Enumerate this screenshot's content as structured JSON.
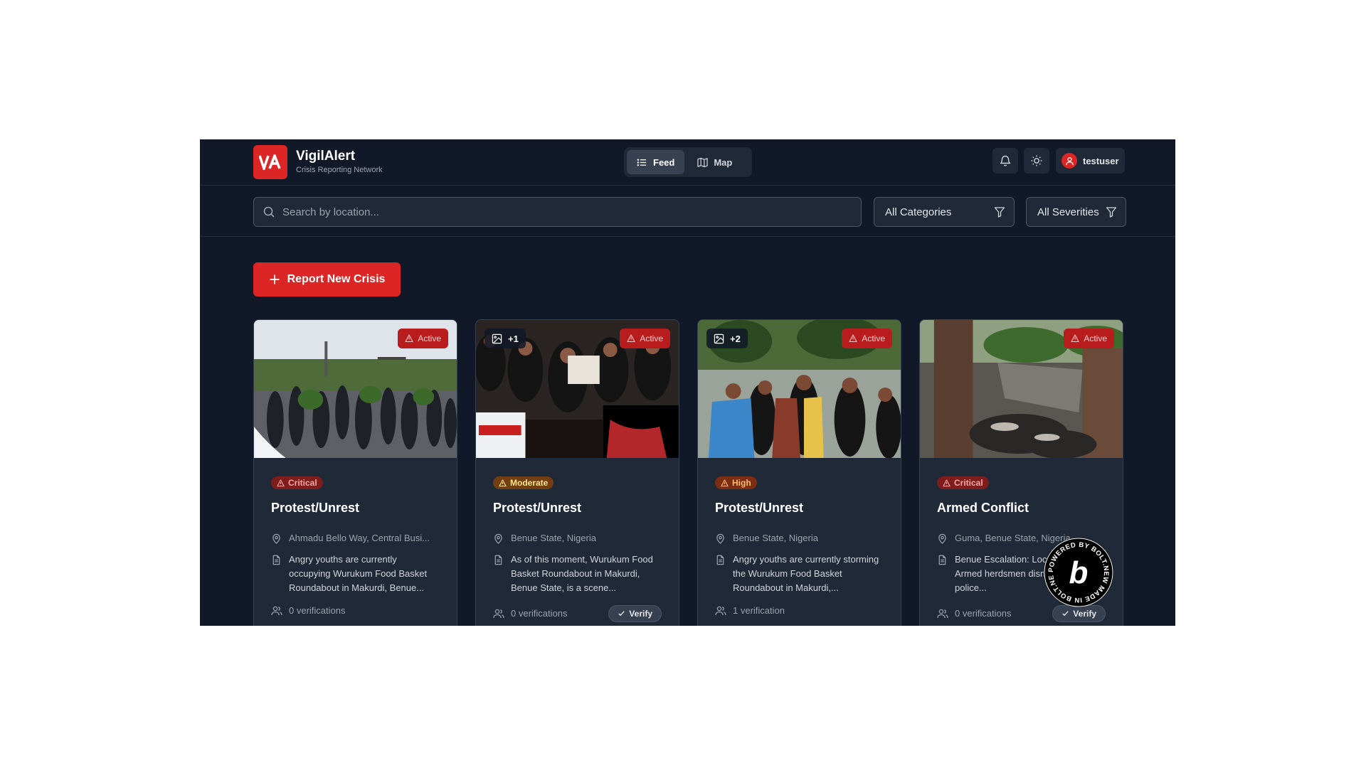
{
  "brand": {
    "logo_text": "VA",
    "title": "VigilAlert",
    "subtitle": "Crisis Reporting Network"
  },
  "nav": {
    "feed_label": "Feed",
    "map_label": "Map",
    "active": "Feed"
  },
  "user": {
    "name": "testuser"
  },
  "filters": {
    "search_placeholder": "Search by location...",
    "category_value": "All Categories",
    "severity_value": "All Severities"
  },
  "report_button": {
    "label": "Report New Crisis"
  },
  "colors": {
    "accent": "#dc2626",
    "background": "#111827",
    "card": "#1f2937"
  },
  "cards": [
    {
      "status": "Active",
      "image_count": "",
      "severity": "Critical",
      "title": "Protest/Unrest",
      "location": "Ahmadu Bello Way, Central Busi...",
      "description": "Angry youths are currently occupying Wurukum Food Basket Roundabout in Makurdi, Benue...",
      "verifications": "0 verifications",
      "verify_label": ""
    },
    {
      "status": "Active",
      "image_count": "+1",
      "severity": "Moderate",
      "title": "Protest/Unrest",
      "location": "Benue State, Nigeria",
      "description": "As of this moment, Wurukum Food Basket Roundabout in Makurdi, Benue State, is a scene...",
      "verifications": "0 verifications",
      "verify_label": "Verify"
    },
    {
      "status": "Active",
      "image_count": "+2",
      "severity": "High",
      "title": "Protest/Unrest",
      "location": "Benue State, Nigeria",
      "description": "Angry youths are currently storming the Wurukum Food Basket Roundabout in Makurdi,...",
      "verifications": "1 verification",
      "verify_label": ""
    },
    {
      "status": "Active",
      "image_count": "",
      "severity": "Critical",
      "title": "Armed Conflict",
      "location": "Guma, Benue State, Nigeria",
      "description": "Benue Escalation: Locals Flee! Armed herdsmen dismissed by police...",
      "verifications": "0 verifications",
      "verify_label": "Verify"
    }
  ],
  "bolt_badge": {
    "text": "POWERED BY BOLT.NEW MADE IN BOLT.NEW",
    "letter": "b"
  },
  "icons": [
    "bell-icon",
    "sun-icon",
    "user-icon",
    "list-icon",
    "map-icon",
    "search-icon",
    "filter-icon",
    "plus-icon",
    "image-icon",
    "alert-triangle-icon",
    "map-pin-icon",
    "file-text-icon",
    "users-icon",
    "check-icon"
  ]
}
